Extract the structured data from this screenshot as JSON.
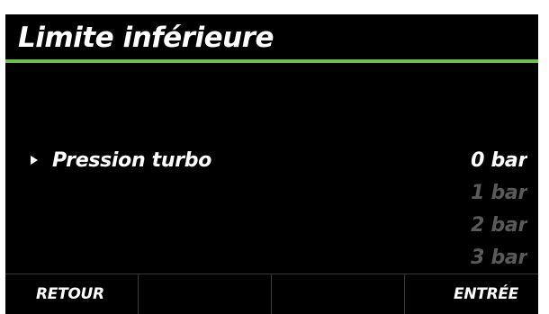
{
  "header": {
    "title": "Limite inférieure"
  },
  "setting": {
    "label": "Pression turbo",
    "pointer_icon": "triangle-right-icon"
  },
  "values": [
    {
      "label": "0 bar",
      "selected": true
    },
    {
      "label": "1 bar",
      "selected": false
    },
    {
      "label": "2 bar",
      "selected": false
    },
    {
      "label": "3 bar",
      "selected": false
    }
  ],
  "softkeys": {
    "key1": "RETOUR",
    "key2": "",
    "key3": "",
    "key4": "ENTRÉE"
  },
  "colors": {
    "background": "#000000",
    "accent": "#6fbf4a",
    "text": "#ffffff",
    "inactive_value": "#5a5a5a"
  }
}
